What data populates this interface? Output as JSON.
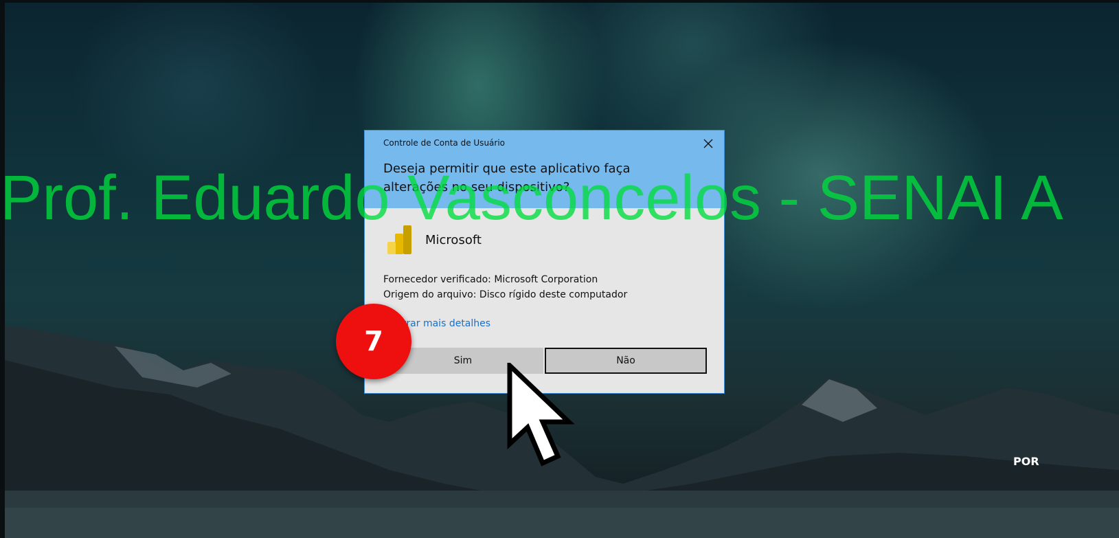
{
  "dialog": {
    "title": "Controle de Conta de Usuário",
    "question": "Deseja permitir que este aplicativo faça alterações no seu dispositivo?",
    "app_name": "Microsoft",
    "publisher": "Fornecedor verificado: Microsoft Corporation",
    "origin": "Origem do arquivo: Disco rígido deste computador",
    "details_link": "Mostrar mais detalhes",
    "yes_label": "Sim",
    "no_label": "Não"
  },
  "overlay": {
    "watermark": "Prof. Eduardo Vasconcelos - SENAI A",
    "step_number": "7"
  },
  "taskbar": {
    "language": "POR"
  },
  "colors": {
    "dialog_header": "#76b9ed",
    "dialog_body": "#e6e6e6",
    "link": "#1a6fc9",
    "watermark": "#00dc3c",
    "badge": "#ee0f0f"
  },
  "icons": {
    "app": "power-bi-icon",
    "close": "close-icon",
    "pointer": "mouse-pointer-icon"
  }
}
